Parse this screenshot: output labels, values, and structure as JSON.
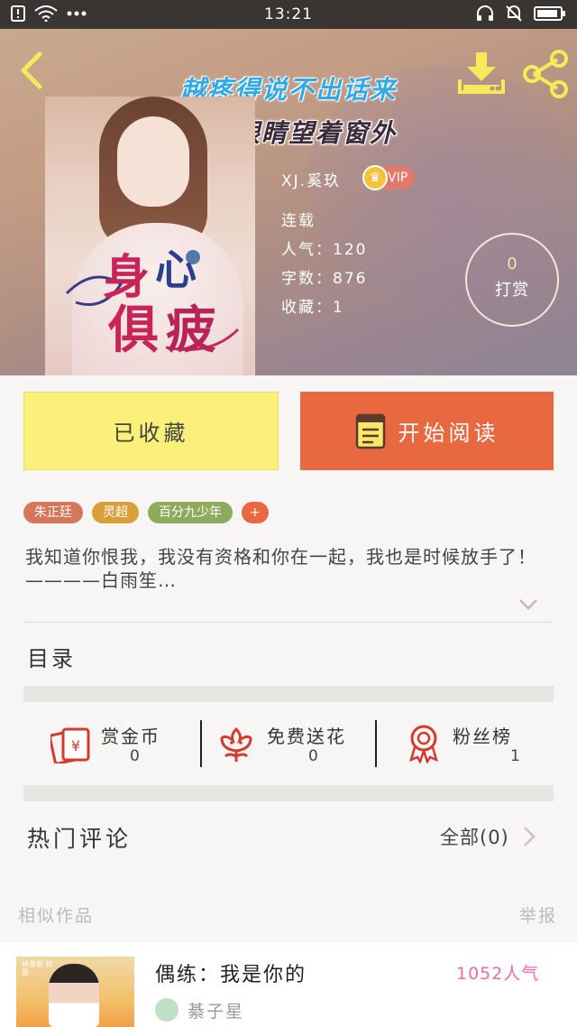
{
  "status_bar": {
    "time": "13:21"
  },
  "header": {
    "title_line1": "越疼得说不出话来",
    "title_line2": "我的眼睛望着窗外"
  },
  "cover": {
    "logo_text": "身心俱疲"
  },
  "book": {
    "author": "XJ.奚玖",
    "vip_label": "VIP",
    "status": "连载",
    "popularity": "人气：120",
    "word_count": "字数：876",
    "collections": "收藏：1"
  },
  "tip": {
    "count": "0",
    "label": "打赏"
  },
  "actions": {
    "favorited_label": "已收藏",
    "read_label": "开始阅读"
  },
  "tags": [
    {
      "label": "朱正廷",
      "color": "#d4775c"
    },
    {
      "label": "灵超",
      "color": "#d9a03a"
    },
    {
      "label": "百分九少年",
      "color": "#8daa5d"
    }
  ],
  "add_tag_label": "+",
  "description": "我知道你恨我，我没有资格和你在一起，我也是时候放手了！————白雨笙…",
  "catalog_label": "目录",
  "stats": [
    {
      "label": "赏金币",
      "value": "0",
      "icon": "red-envelope-icon"
    },
    {
      "label": "免费送花",
      "value": "0",
      "icon": "flower-icon"
    },
    {
      "label": "粉丝榜",
      "value": "1",
      "icon": "medal-icon"
    }
  ],
  "comments": {
    "title": "热门评论",
    "all_label": "全部(0)"
  },
  "similar": {
    "title": "相似作品",
    "report_label": "举报"
  },
  "similar_books": [
    {
      "title": "偶练：我是你的",
      "popularity": "1052人气",
      "author": "綦子星",
      "thumb_caption": "林彦俊 封面"
    }
  ],
  "colors": {
    "favorite_bg": "#faf07a",
    "read_bg": "#e8683f",
    "popularity_pink": "#f06aa8",
    "title_blue": "#2fa9e8"
  }
}
